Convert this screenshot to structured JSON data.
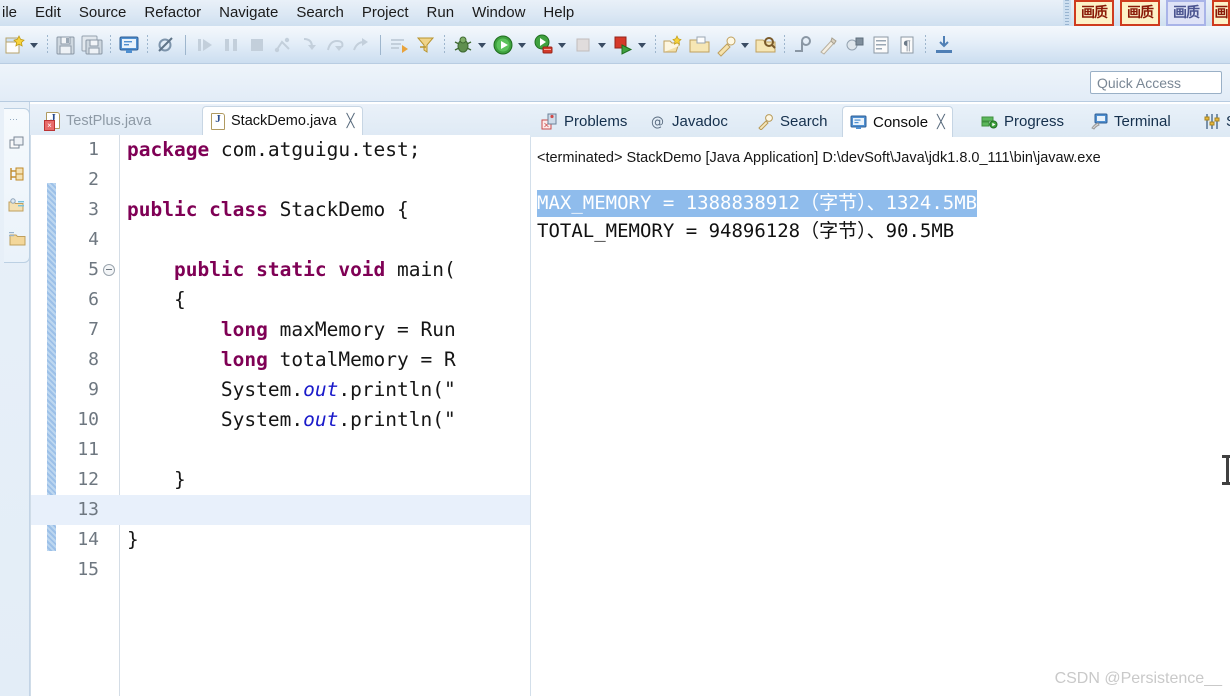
{
  "window": {
    "menus": [
      "ile",
      "Edit",
      "Source",
      "Refactor",
      "Navigate",
      "Search",
      "Project",
      "Run",
      "Window",
      "Help"
    ],
    "overlay_buttons": [
      {
        "label": "画质",
        "style": "active"
      },
      {
        "label": "画质",
        "style": "active"
      },
      {
        "label": "画质",
        "style": "alt"
      },
      {
        "label": "画",
        "style": "active"
      }
    ]
  },
  "toolbar": {
    "icons": [
      {
        "name": "new-wizard-icon",
        "label": "New"
      },
      {
        "name": "new-dropdown-arrow",
        "label": "New menu"
      },
      {
        "name": "save-icon",
        "label": "Save"
      },
      {
        "name": "save-all-icon",
        "label": "Save All"
      },
      {
        "name": "console-icon",
        "label": "Open Console"
      },
      {
        "name": "skip-breakpoints-icon",
        "label": "Skip All Breakpoints"
      },
      {
        "name": "resume-icon",
        "label": "Resume"
      },
      {
        "name": "suspend-icon",
        "label": "Suspend"
      },
      {
        "name": "terminate-icon",
        "label": "Terminate"
      },
      {
        "name": "disconnect-icon",
        "label": "Disconnect"
      },
      {
        "name": "step-into-icon",
        "label": "Step Into"
      },
      {
        "name": "step-over-icon",
        "label": "Step Over"
      },
      {
        "name": "step-return-icon",
        "label": "Step Return"
      },
      {
        "name": "drop-to-frame-icon",
        "label": "Drop to Frame"
      },
      {
        "name": "use-step-filters-icon",
        "label": "Use Step Filters"
      },
      {
        "name": "debug-icon",
        "label": "Debug"
      },
      {
        "name": "debug-dropdown-arrow",
        "label": "Debug History"
      },
      {
        "name": "run-icon",
        "label": "Run"
      },
      {
        "name": "run-dropdown-arrow",
        "label": "Run History"
      },
      {
        "name": "external-tools-icon",
        "label": "External Tools"
      },
      {
        "name": "external-dropdown-arrow",
        "label": "External Tools menu"
      },
      {
        "name": "coverage-icon",
        "label": "Coverage"
      },
      {
        "name": "coverage-dropdown-arrow",
        "label": "Coverage History"
      },
      {
        "name": "run-last-icon",
        "label": "Run Last Tool"
      },
      {
        "name": "run-last-dropdown-arrow",
        "label": "Run Last menu"
      },
      {
        "name": "new-java-package-icon",
        "label": "New Java Package"
      },
      {
        "name": "new-class-icon",
        "label": "New Java Class"
      },
      {
        "name": "open-type-icon",
        "label": "Open Type"
      },
      {
        "name": "search-icon",
        "label": "Search"
      },
      {
        "name": "search-dropdown-arrow",
        "label": "Search menu"
      },
      {
        "name": "open-task-icon",
        "label": "Open Task"
      },
      {
        "name": "next-annotation-icon",
        "label": "Next Annotation"
      },
      {
        "name": "previous-annotation-icon",
        "label": "Previous Annotation"
      },
      {
        "name": "last-edit-location-icon",
        "label": "Last Edit Location"
      },
      {
        "name": "back-icon",
        "label": "Back"
      },
      {
        "name": "forward-icon",
        "label": "Forward"
      },
      {
        "name": "pin-editor-icon",
        "label": "Pin Editor"
      }
    ]
  },
  "quick_access": {
    "placeholder": "Quick Access",
    "value": ""
  },
  "fast_view": {
    "icons": [
      {
        "name": "restore-icon",
        "label": "Restore"
      },
      {
        "name": "outline-view-icon",
        "label": "Outline"
      },
      {
        "name": "package-explorer-icon",
        "label": "Package Explorer"
      },
      {
        "name": "project-explorer-icon",
        "label": "Project Explorer"
      }
    ]
  },
  "editor": {
    "tabs": [
      {
        "label": "TestPlus.java",
        "active": false,
        "has_error": true,
        "closable": false
      },
      {
        "label": "StackDemo.java",
        "active": true,
        "has_error": false,
        "closable": true,
        "close_glyph": "╳"
      }
    ],
    "current_line": 13,
    "lines": [
      {
        "num": "1",
        "folding": false,
        "tokens": [
          {
            "t": "package",
            "c": "kw"
          },
          {
            "t": " com.atguigu.test;",
            "c": "plain"
          }
        ]
      },
      {
        "num": "2",
        "folding": false,
        "tokens": []
      },
      {
        "num": "3",
        "folding": false,
        "tokens": [
          {
            "t": "public class",
            "c": "kw"
          },
          {
            "t": " StackDemo {",
            "c": "plain"
          }
        ]
      },
      {
        "num": "4",
        "folding": false,
        "tokens": []
      },
      {
        "num": "5",
        "folding": true,
        "tokens": [
          {
            "t": "    ",
            "c": "plain"
          },
          {
            "t": "public static void",
            "c": "kw"
          },
          {
            "t": " main(",
            "c": "plain"
          }
        ]
      },
      {
        "num": "6",
        "folding": false,
        "tokens": [
          {
            "t": "    {",
            "c": "plain"
          }
        ]
      },
      {
        "num": "7",
        "folding": false,
        "tokens": [
          {
            "t": "        ",
            "c": "plain"
          },
          {
            "t": "long",
            "c": "kw"
          },
          {
            "t": " maxMemory = Run",
            "c": "plain"
          }
        ]
      },
      {
        "num": "8",
        "folding": false,
        "tokens": [
          {
            "t": "        ",
            "c": "plain"
          },
          {
            "t": "long",
            "c": "kw"
          },
          {
            "t": " totalMemory = R",
            "c": "plain"
          }
        ]
      },
      {
        "num": "9",
        "folding": false,
        "tokens": [
          {
            "t": "        System.",
            "c": "plain"
          },
          {
            "t": "out",
            "c": "sfield"
          },
          {
            "t": ".println(\"",
            "c": "plain"
          }
        ]
      },
      {
        "num": "10",
        "folding": false,
        "tokens": [
          {
            "t": "        System.",
            "c": "plain"
          },
          {
            "t": "out",
            "c": "sfield"
          },
          {
            "t": ".println(\"",
            "c": "plain"
          }
        ]
      },
      {
        "num": "11",
        "folding": false,
        "tokens": []
      },
      {
        "num": "12",
        "folding": false,
        "tokens": [
          {
            "t": "    }",
            "c": "plain"
          }
        ]
      },
      {
        "num": "13",
        "folding": false,
        "tokens": []
      },
      {
        "num": "14",
        "folding": false,
        "tokens": [
          {
            "t": "}",
            "c": "plain"
          }
        ]
      },
      {
        "num": "15",
        "folding": false,
        "tokens": []
      }
    ]
  },
  "bottom_view": {
    "tabs": [
      {
        "label": "Problems",
        "icon": "problems-icon",
        "active": false,
        "closable": false
      },
      {
        "label": "Javadoc",
        "icon": "javadoc-icon",
        "active": false,
        "closable": false
      },
      {
        "label": "Search",
        "icon": "search-icon",
        "active": false,
        "closable": false
      },
      {
        "label": "Console",
        "icon": "console-icon",
        "active": true,
        "closable": true,
        "close_glyph": "╳"
      },
      {
        "label": "Progress",
        "icon": "progress-icon",
        "active": false,
        "closable": false
      },
      {
        "label": "Terminal",
        "icon": "terminal-icon",
        "active": false,
        "closable": false
      },
      {
        "label": "S",
        "icon": "servers-icon",
        "active": false,
        "closable": false
      }
    ]
  },
  "console": {
    "launch_header": "<terminated> StackDemo [Java Application] D:\\devSoft\\Java\\jdk1.8.0_111\\bin\\javaw.exe",
    "lines": [
      {
        "text": "MAX_MEMORY = 1388838912（字节）、1324.5MB",
        "selected": true
      },
      {
        "text": "TOTAL_MEMORY = 94896128（字节）、90.5MB",
        "selected": false
      }
    ],
    "selection_bg": "#8fbcec",
    "selection_fg": "#ffffff"
  },
  "watermark": {
    "text": "CSDN @Persistence__"
  },
  "colors": {
    "keyword": "#7f0055",
    "static_field": "#1a1aca",
    "chrome": "#dce8f4",
    "current_line": "#e8f0fb",
    "change_bar": "#a8c8ec"
  }
}
